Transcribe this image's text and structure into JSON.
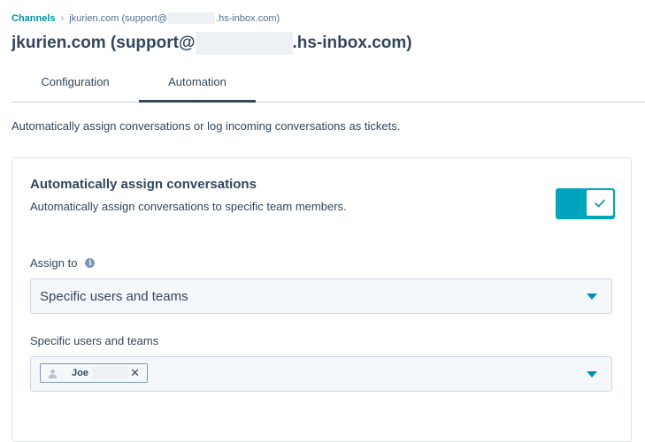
{
  "breadcrumb": {
    "root": "Channels",
    "current_prefix": "jkurien.com (support@",
    "current_suffix": ".hs-inbox.com)"
  },
  "page_title": {
    "prefix": "jkurien.com (support@",
    "suffix": ".hs-inbox.com)"
  },
  "tabs": [
    {
      "label": "Configuration",
      "active": false
    },
    {
      "label": "Automation",
      "active": true
    }
  ],
  "intro_text": "Automatically assign conversations or log incoming conversations as tickets.",
  "auto_assign": {
    "title": "Automatically assign conversations",
    "description": "Automatically assign conversations to specific team members.",
    "enabled": true,
    "assign_to_label": "Assign to",
    "assign_to_value": "Specific users and teams",
    "users_label": "Specific users and teams",
    "selected_users": [
      {
        "name": "Joe"
      }
    ]
  },
  "colors": {
    "accent": "#00a4bd",
    "link": "#0091ae",
    "text": "#33475b"
  },
  "icons": [
    "chevron-right-icon",
    "info-icon",
    "checkmark-icon",
    "caret-down-icon",
    "user-avatar-icon",
    "close-icon"
  ]
}
